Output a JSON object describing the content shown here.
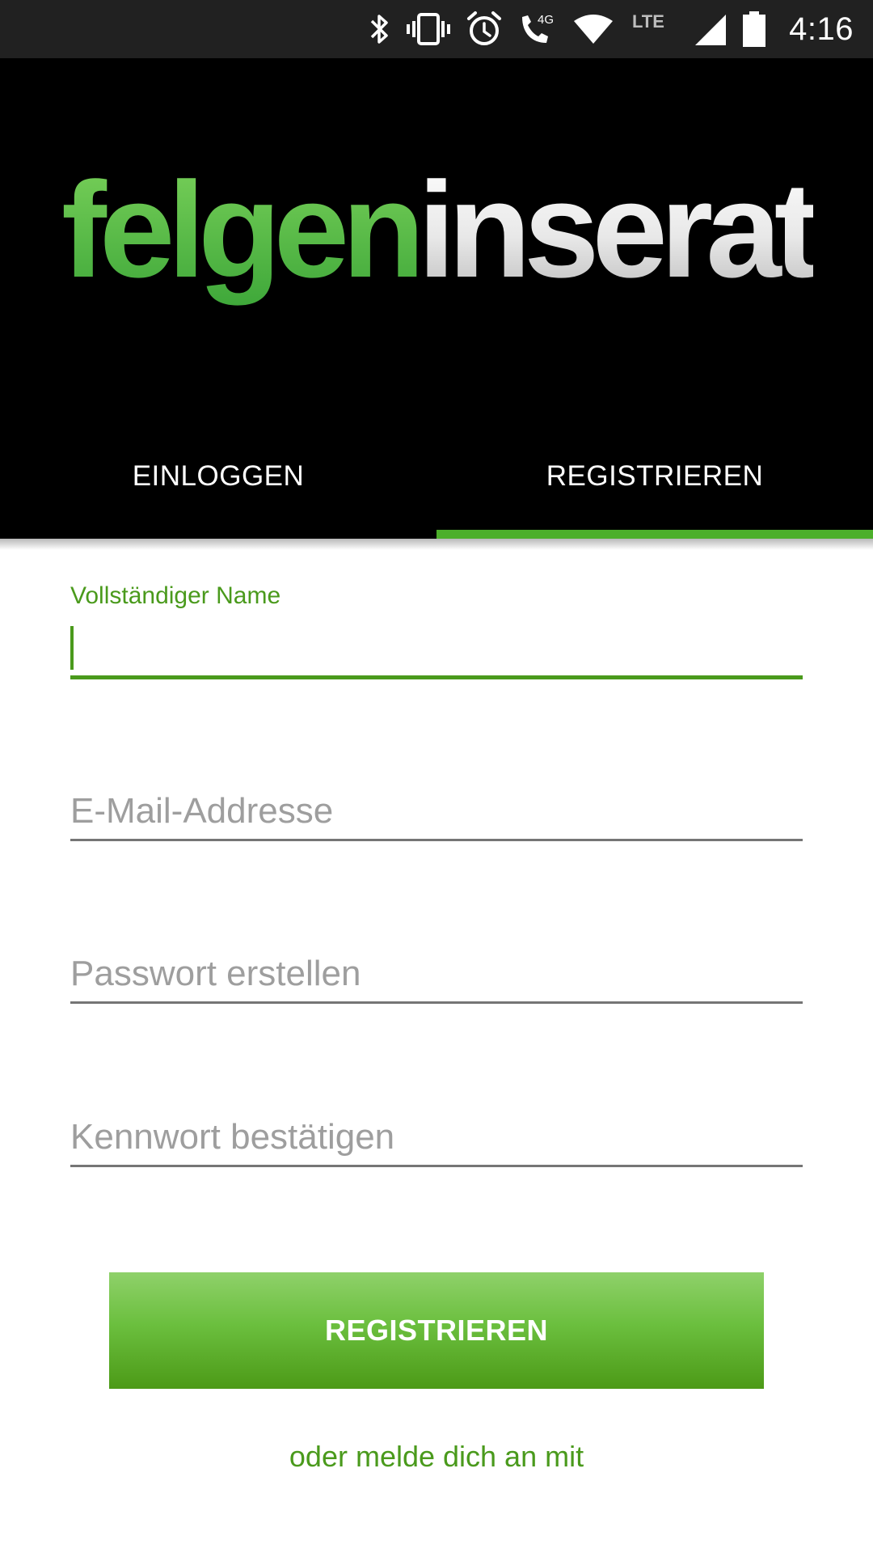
{
  "status_bar": {
    "time": "4:16",
    "icons": [
      "bluetooth-icon",
      "vibrate-icon",
      "alarm-icon",
      "volte-call-icon",
      "wifi-icon",
      "lte-icon",
      "cell-signal-icon",
      "battery-icon"
    ],
    "call_badge": "4G",
    "network_badge": "LTE"
  },
  "header": {
    "logo": {
      "part1": "felgen",
      "part2": "inserate",
      "part1_color": "#5cc043",
      "part2_color": "#e6e6e6"
    }
  },
  "tabs": {
    "items": [
      {
        "label": "EINLOGGEN"
      },
      {
        "label": "REGISTRIEREN"
      }
    ],
    "selected": "REGISTRIEREN",
    "accent_color": "#4caf2a"
  },
  "form": {
    "full_name": {
      "label": "Vollständiger Name",
      "value": ""
    },
    "email": {
      "placeholder": "E-Mail-Addresse",
      "value": ""
    },
    "password": {
      "placeholder": "Passwort erstellen",
      "value": ""
    },
    "confirm_password": {
      "placeholder": "Kennwort bestätigen",
      "value": ""
    },
    "submit_label": "REGISTRIEREN",
    "alt_login_text": "oder melde dich an mit"
  },
  "colors": {
    "accent_green": "#4a9a1c",
    "button_gradient_top": "#8fd16a",
    "button_gradient_bottom": "#4c9a17",
    "header_background": "#000000",
    "status_bar_background": "#212121"
  }
}
